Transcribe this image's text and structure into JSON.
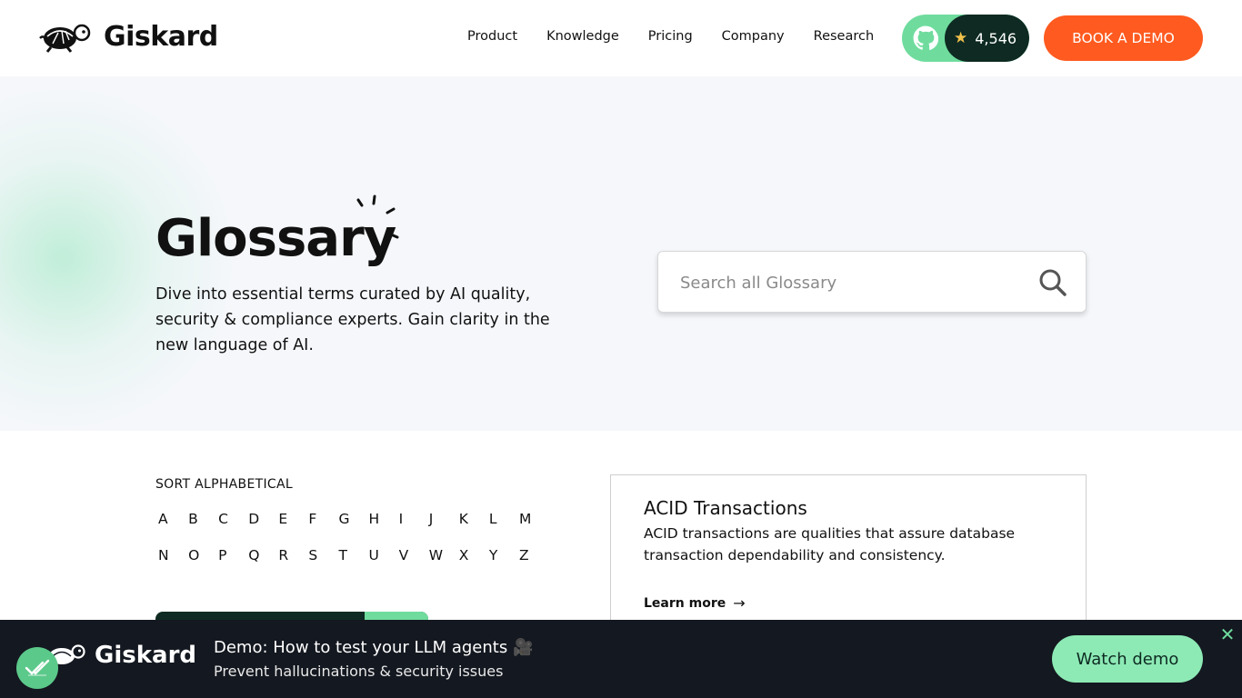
{
  "header": {
    "brand": "Giskard",
    "nav": [
      "Product",
      "Knowledge",
      "Pricing",
      "Company",
      "Research"
    ],
    "github_stars": "4,546",
    "book_demo": "BOOK A DEMO"
  },
  "hero": {
    "title": "Glossary",
    "description": "Dive into essential terms curated by AI quality, security & compliance experts. Gain clarity in the new language of AI.",
    "search_placeholder": "Search all Glossary"
  },
  "sort": {
    "title": "SORT ALPHABETICAL",
    "row1": [
      "A",
      "B",
      "C",
      "D",
      "E",
      "F",
      "G",
      "H",
      "I",
      "J",
      "K",
      "L",
      "M"
    ],
    "row2": [
      "N",
      "O",
      "P",
      "Q",
      "R",
      "S",
      "T",
      "U",
      "V",
      "W",
      "X",
      "Y",
      "Z"
    ]
  },
  "card": {
    "title": "ACID Transactions",
    "description": "ACID transactions are qualities that assure database transaction dependability and consistency.",
    "link": "Learn more"
  },
  "banner": {
    "brand": "Giskard",
    "title": "Demo: How to test your LLM agents 🎥",
    "subtitle": "Prevent hallucinations & security issues",
    "cta": "Watch demo"
  },
  "colors": {
    "accent_green": "#6fdc9e",
    "dark_green": "#0e2a22",
    "orange": "#ff5a1f",
    "banner_bg": "#141820"
  }
}
